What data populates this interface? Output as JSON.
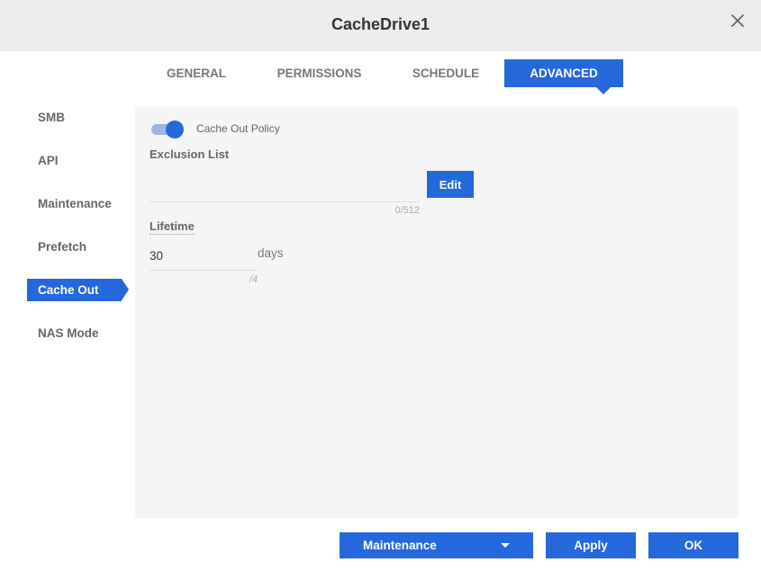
{
  "window": {
    "title": "CacheDrive1",
    "close_icon": "close-icon"
  },
  "tabs": [
    {
      "label": "GENERAL",
      "active": false
    },
    {
      "label": "PERMISSIONS",
      "active": false
    },
    {
      "label": "SCHEDULE",
      "active": false
    },
    {
      "label": "ADVANCED",
      "active": true
    }
  ],
  "sidebar": {
    "items": [
      {
        "label": "SMB",
        "active": false
      },
      {
        "label": "API",
        "active": false
      },
      {
        "label": "Maintenance",
        "active": false
      },
      {
        "label": "Prefetch",
        "active": false
      },
      {
        "label": "Cache Out",
        "active": true
      },
      {
        "label": "NAS Mode",
        "active": false
      }
    ]
  },
  "cache_out": {
    "policy_toggle": {
      "label": "Cache Out Policy",
      "enabled": true
    },
    "exclusion_list": {
      "label": "Exclusion List",
      "value": "",
      "counter": "0/512",
      "edit_label": "Edit"
    },
    "lifetime": {
      "label": "Lifetime",
      "value": "30",
      "unit": "days",
      "counter": "/4"
    }
  },
  "footer": {
    "maintenance_label": "Maintenance",
    "apply_label": "Apply",
    "ok_label": "OK"
  },
  "colors": {
    "accent": "#2468dc",
    "titlebar_bg": "#ececec",
    "panel_bg": "#f5f5f5"
  }
}
